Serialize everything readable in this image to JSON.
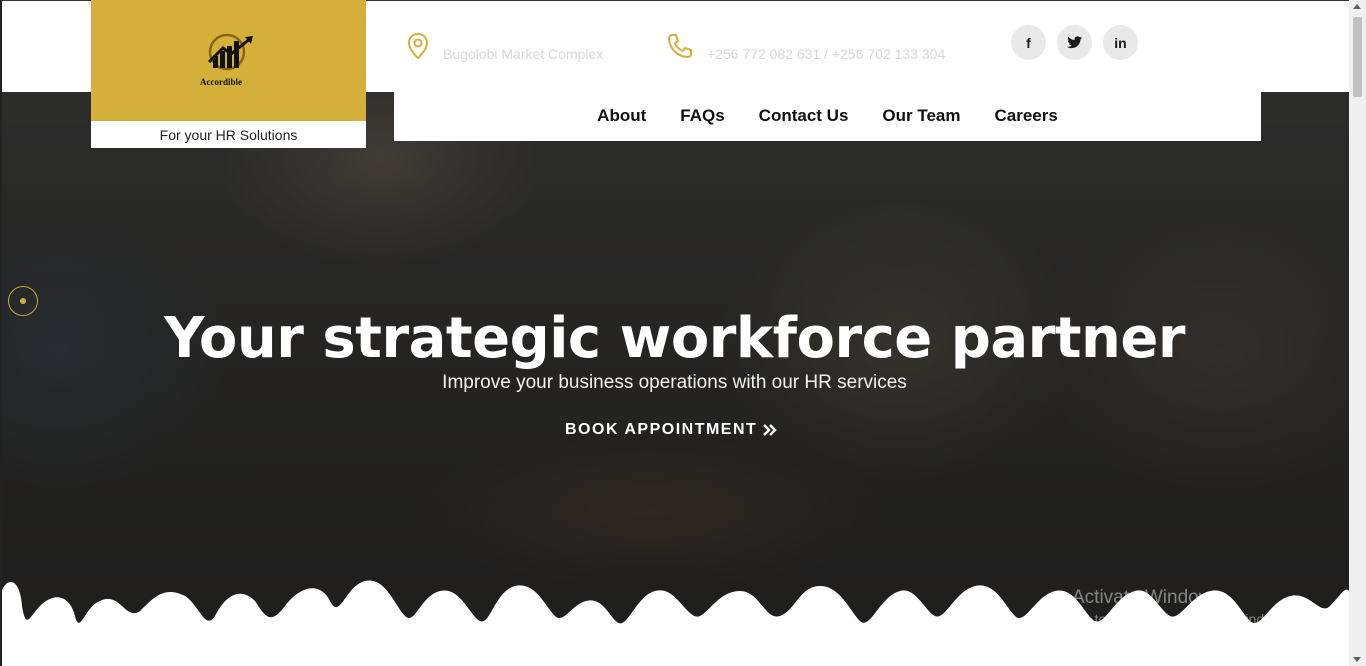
{
  "brand": {
    "name": "Accordible",
    "tagline": "For your HR Solutions",
    "accent": "#d4b03a"
  },
  "contact": {
    "address": "Bugolobi Market Complex",
    "phone": "+256 772 082 631 / +256 702 133 304",
    "address_icon": "map-pin-icon",
    "phone_icon": "phone-icon"
  },
  "social": [
    {
      "label": "f",
      "icon": "facebook-icon"
    },
    {
      "label": "t",
      "icon": "twitter-icon"
    },
    {
      "label": "in",
      "icon": "linkedin-icon"
    }
  ],
  "nav": {
    "items": [
      {
        "label": "About"
      },
      {
        "label": "FAQs"
      },
      {
        "label": "Contact Us"
      },
      {
        "label": "Our Team"
      },
      {
        "label": "Careers"
      }
    ]
  },
  "hero": {
    "title": "Your strategic workforce partner",
    "subtitle": "Improve your business operations with our HR services",
    "cta_label": "BOOK APPOINTMENT",
    "cta_icon": "double-chevron-right-icon"
  },
  "watermark": {
    "line1": "Activate Windows",
    "line2": "Go to Settings to activate Windows."
  }
}
